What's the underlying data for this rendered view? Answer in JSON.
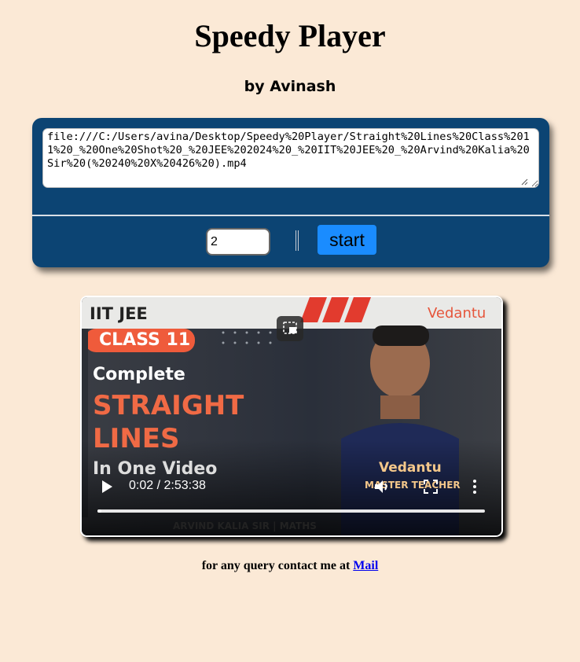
{
  "header": {
    "title": "Speedy Player",
    "byline": "by Avinash"
  },
  "controls": {
    "url_value": "file:///C:/Users/avina/Desktop/Speedy%20Player/Straight%20Lines%20Class%2011%20_%20One%20Shot%20_%20JEE%202024%20_%20IIT%20JEE%20_%20Arvind%20Kalia%20Sir%20(%20240%20X%20426%20).mp4",
    "speed_value": "2",
    "start_label": "start"
  },
  "video": {
    "time_display": "0:02 / 2:53:38",
    "progress_fraction": 0.01,
    "thumbnail": {
      "badge_top": "IIT JEE",
      "badge_class": "CLASS 11",
      "line1": "Complete",
      "line2": "STRAIGHT",
      "line3": "LINES",
      "line4": "In One Video",
      "brand": "Vedantu",
      "shirt_line1": "Vedantu",
      "shirt_line2": "MASTER TEACHER",
      "bottom_text": "ARVIND KALIA SIR | MATHS"
    },
    "icons": [
      "play-icon",
      "volume-icon",
      "fullscreen-icon",
      "more-options-icon",
      "picture-in-picture-icon"
    ]
  },
  "footer": {
    "text": "for any query contact me at",
    "link_label": "Mail"
  },
  "colors": {
    "background": "#fbe9d6",
    "panel": "#0c4473",
    "start_button": "#1a8cff",
    "link": "#0000ee"
  }
}
